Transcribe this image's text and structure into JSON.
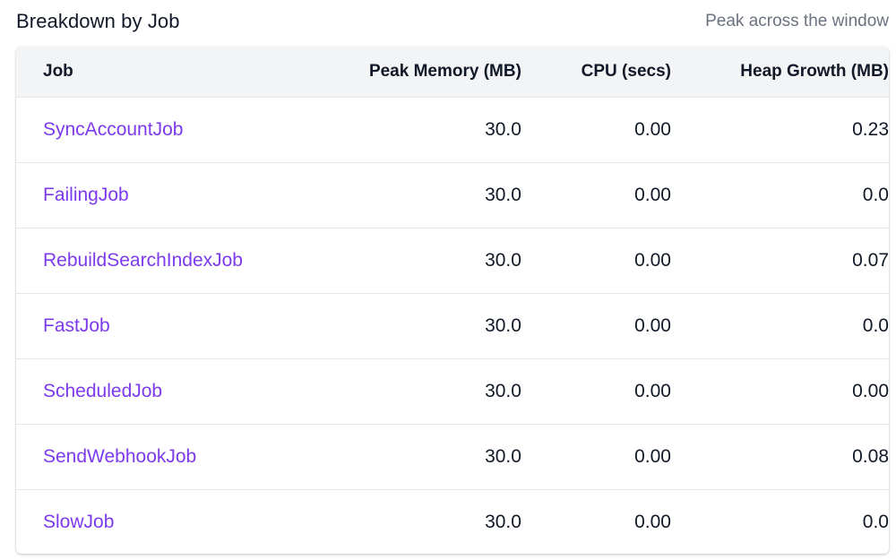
{
  "section": {
    "title": "Breakdown by Job",
    "note": "Peak across the window"
  },
  "table": {
    "headers": {
      "job": "Job",
      "peak_memory": "Peak Memory (MB)",
      "cpu": "CPU (secs)",
      "heap_growth": "Heap Growth (MB)"
    },
    "rows": [
      {
        "job": "SyncAccountJob",
        "peak_memory": "30.0",
        "cpu": "0.00",
        "heap_growth": "0.23"
      },
      {
        "job": "FailingJob",
        "peak_memory": "30.0",
        "cpu": "0.00",
        "heap_growth": "0.0"
      },
      {
        "job": "RebuildSearchIndexJob",
        "peak_memory": "30.0",
        "cpu": "0.00",
        "heap_growth": "0.07"
      },
      {
        "job": "FastJob",
        "peak_memory": "30.0",
        "cpu": "0.00",
        "heap_growth": "0.0"
      },
      {
        "job": "ScheduledJob",
        "peak_memory": "30.0",
        "cpu": "0.00",
        "heap_growth": "0.00"
      },
      {
        "job": "SendWebhookJob",
        "peak_memory": "30.0",
        "cpu": "0.00",
        "heap_growth": "0.08"
      },
      {
        "job": "SlowJob",
        "peak_memory": "30.0",
        "cpu": "0.00",
        "heap_growth": "0.0"
      }
    ]
  },
  "colors": {
    "link": "#7c3aed",
    "header_bg": "#f3f4f6",
    "border": "#e5e7eb"
  }
}
